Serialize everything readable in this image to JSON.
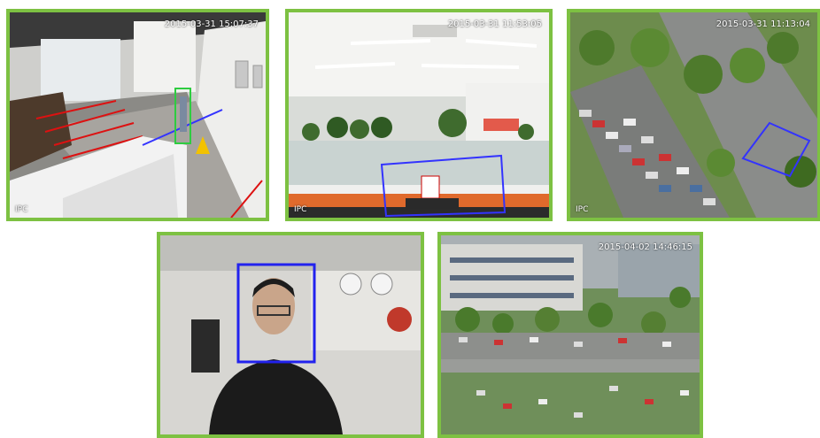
{
  "cameras": [
    {
      "id": "cam1",
      "timestamp": "2015-03-31 15:07:37",
      "label": "IPC",
      "detection": "person",
      "detection_color": "#2ecc40"
    },
    {
      "id": "cam2",
      "timestamp": "2015-03-31 11:53:05",
      "label": "IPC",
      "detection": "object-left",
      "detection_color": "#3333ff"
    },
    {
      "id": "cam3",
      "timestamp": "2015-03-31 11:13:04",
      "label": "IPC",
      "detection": "region",
      "detection_color": "#3333ff"
    },
    {
      "id": "cam4",
      "timestamp": "",
      "label": "",
      "detection": "face",
      "detection_color": "#2222ee"
    },
    {
      "id": "cam5",
      "timestamp": "2015-04-02 14:46:15",
      "label": "",
      "detection": "none",
      "detection_color": ""
    }
  ],
  "frame_color": "#7dc142"
}
